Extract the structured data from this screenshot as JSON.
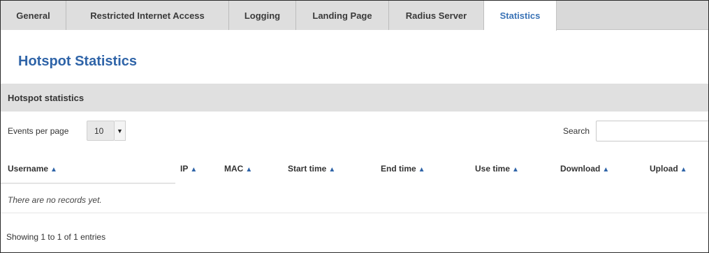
{
  "tabs": [
    {
      "label": "General",
      "active": false
    },
    {
      "label": "Restricted Internet Access",
      "active": false
    },
    {
      "label": "Logging",
      "active": false
    },
    {
      "label": "Landing Page",
      "active": false
    },
    {
      "label": "Radius Server",
      "active": false
    },
    {
      "label": "Statistics",
      "active": true
    }
  ],
  "page": {
    "title": "Hotspot Statistics"
  },
  "section": {
    "title": "Hotspot statistics"
  },
  "controls": {
    "events_per_page_label": "Events per page",
    "events_per_page_value": "10",
    "search_label": "Search",
    "search_value": "",
    "search_placeholder": ""
  },
  "table": {
    "columns": [
      "Username",
      "IP",
      "MAC",
      "Start time",
      "End time",
      "Use time",
      "Download",
      "Upload"
    ],
    "sort_icon": "sort-asc-icon",
    "empty_message": "There are no records yet."
  },
  "footer": {
    "info": "Showing 1 to 1 of 1 entries"
  },
  "colors": {
    "accent": "#2f64a8",
    "tab_bar": "#d9d9d9",
    "section_bar": "#e0e0e0"
  }
}
